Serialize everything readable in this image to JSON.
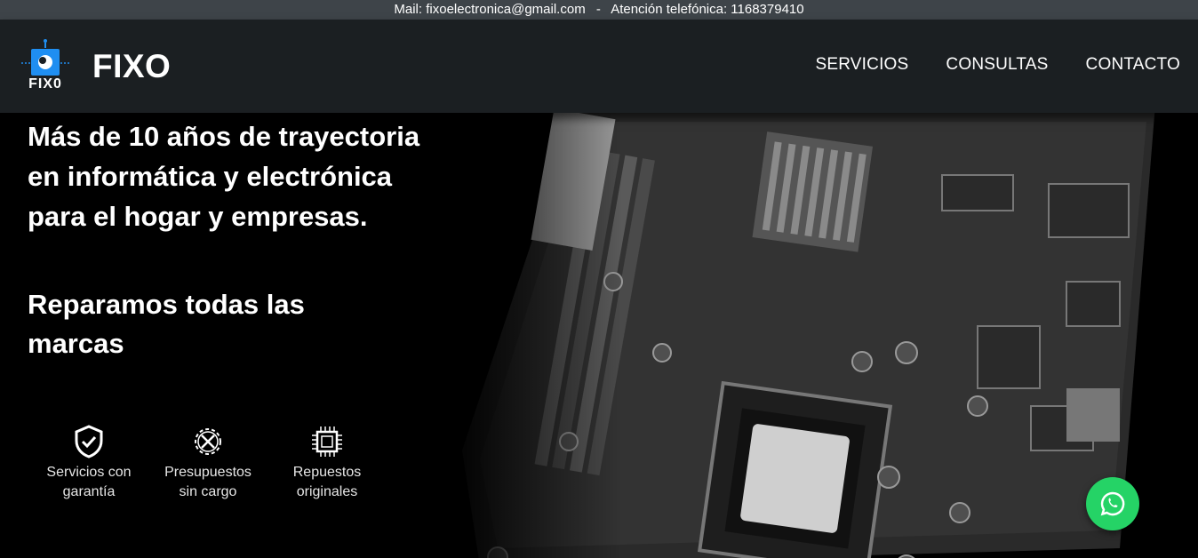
{
  "topbar": {
    "mail": "Mail: fixoelectronica@gmail.com",
    "separator": "-",
    "phone": "Atención telefónica: 1168379410"
  },
  "header": {
    "logo_text": "FIX0",
    "brand": "FIXO",
    "nav": [
      {
        "label": "SERVICIOS"
      },
      {
        "label": "CONSULTAS"
      },
      {
        "label": "CONTACTO"
      }
    ]
  },
  "hero": {
    "headline": "Más de 10 años de trayectoria en informática y electrónica para el hogar y empresas.",
    "subheadline": "Reparamos todas las marcas",
    "features": [
      {
        "icon": "shield-check-icon",
        "label": "Servicios con garantía"
      },
      {
        "icon": "gear-tools-icon",
        "label": "Presupuestos sin cargo"
      },
      {
        "icon": "chip-icon",
        "label": "Repuestos originales"
      }
    ]
  },
  "whatsapp": {
    "icon": "whatsapp-icon",
    "color": "#25d366"
  },
  "colors": {
    "topbar": "#3e4449",
    "navbar": "#1b1f22",
    "background": "#000000",
    "accent_blue": "#1f8ef1"
  }
}
